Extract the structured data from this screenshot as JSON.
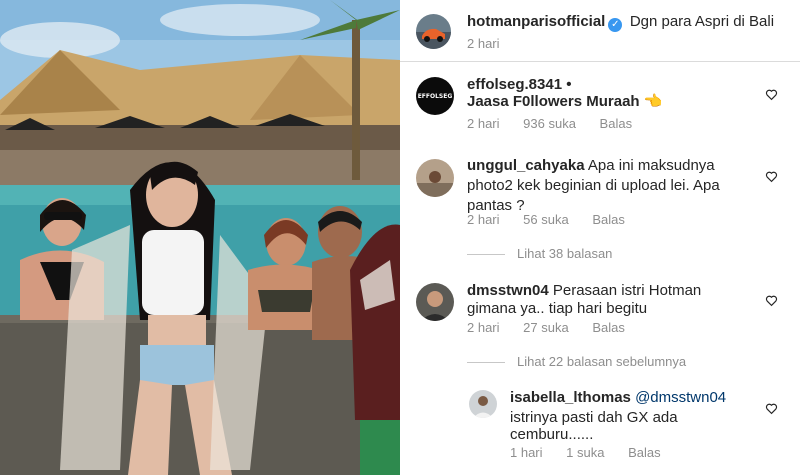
{
  "post": {
    "author": "hotmanparisofficial",
    "caption": "Dgn para Aspri di Bali",
    "time": "2 hari"
  },
  "comments": [
    {
      "user": "effolseg.8341",
      "separator": " •",
      "text": "Jaasa F0llowers Muraah 👈",
      "time": "2 hari",
      "likes": "936 suka",
      "reply": "Balas"
    },
    {
      "user": "unggul_cahyaka",
      "text_line1": "Apa ini maksudnya",
      "text_line2": "photo2 kek beginian di upload lei. Apa",
      "text_line3": "pantas ?",
      "time": "2 hari",
      "likes": "56 suka",
      "reply": "Balas",
      "view_replies": "Lihat 38 balasan"
    },
    {
      "user": "dmsstwn04",
      "text_line1": "Perasaan istri Hotman",
      "text_line2": "gimana ya.. tiap hari begitu",
      "time": "2 hari",
      "likes": "27 suka",
      "reply": "Balas",
      "view_replies": "Lihat 22 balasan sebelumnya"
    }
  ],
  "reply_comment": {
    "user": "isabella_lthomas",
    "mention": "@dmsstwn04",
    "text_line1": "istrinya pasti dah GX ada",
    "text_line2": "cemburu......",
    "time": "1 hari",
    "likes": "1 suka",
    "reply": "Balas"
  },
  "icons": {
    "verified": "verified-badge-icon",
    "heart": "heart-outline-icon"
  },
  "colors": {
    "verified": "#3897f0",
    "link": "#00376b",
    "muted": "#8e8e8e"
  }
}
